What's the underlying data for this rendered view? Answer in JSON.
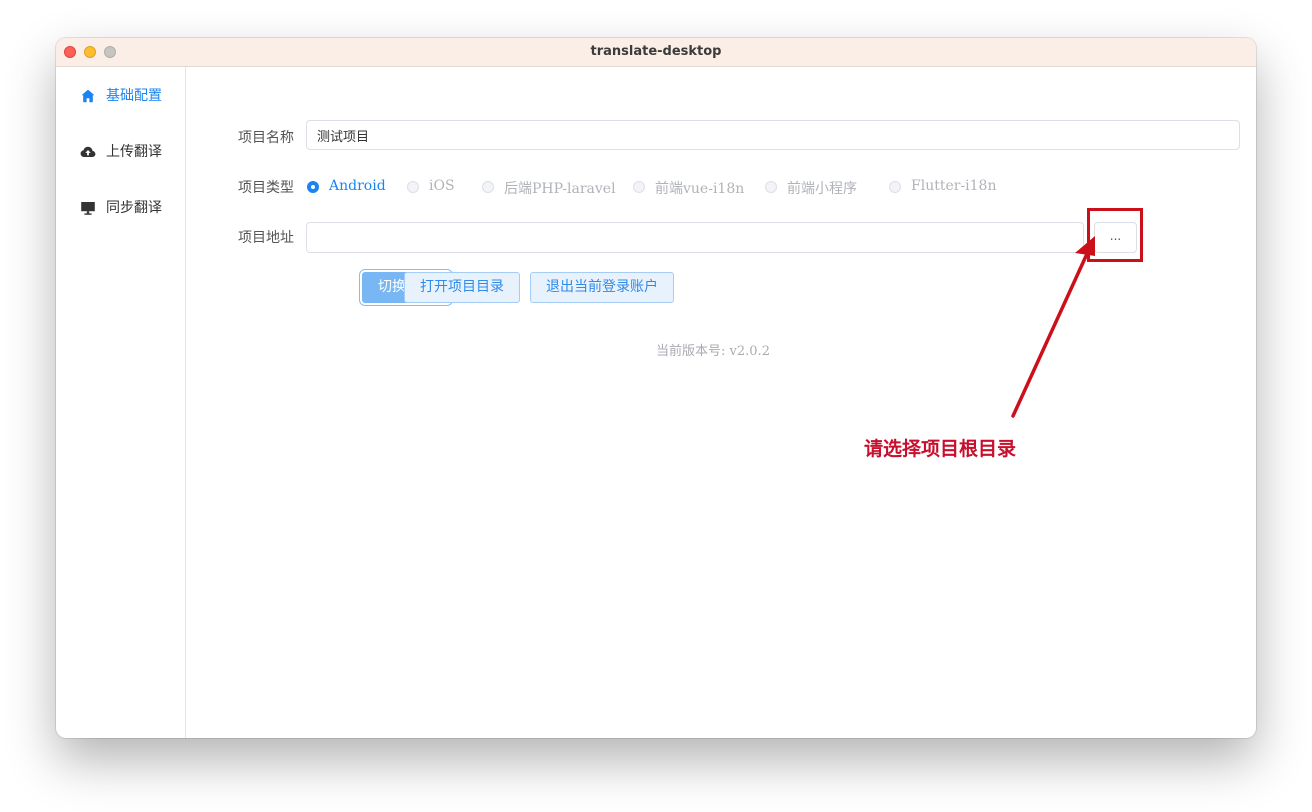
{
  "window": {
    "title": "translate-desktop"
  },
  "sidebar": {
    "items": [
      {
        "label": "基础配置",
        "icon": "home-icon",
        "active": true
      },
      {
        "label": "上传翻译",
        "icon": "cloud-upload-icon",
        "active": false
      },
      {
        "label": "同步翻译",
        "icon": "monitor-icon",
        "active": false
      }
    ]
  },
  "form": {
    "project_name": {
      "label": "项目名称",
      "value": "测试项目"
    },
    "project_type": {
      "label": "项目类型",
      "options": [
        "Android",
        "iOS",
        "后端PHP-laravel",
        "前端vue-i18n",
        "前端小程序",
        "Flutter-i18n"
      ],
      "selected": "Android"
    },
    "project_path": {
      "label": "项目地址",
      "value": "",
      "browse_label": "..."
    }
  },
  "actions": {
    "switch_project": "切换项目",
    "open_directory": "打开项目目录",
    "logout": "退出当前登录账户"
  },
  "version": {
    "text": "当前版本号: v2.0.2"
  },
  "annotation": {
    "text": "请选择项目根目录",
    "color": "#c8102e"
  },
  "colors": {
    "accent": "#1a84f2",
    "titlebar": "#fbeee6",
    "annotation_red": "#cc101a"
  }
}
